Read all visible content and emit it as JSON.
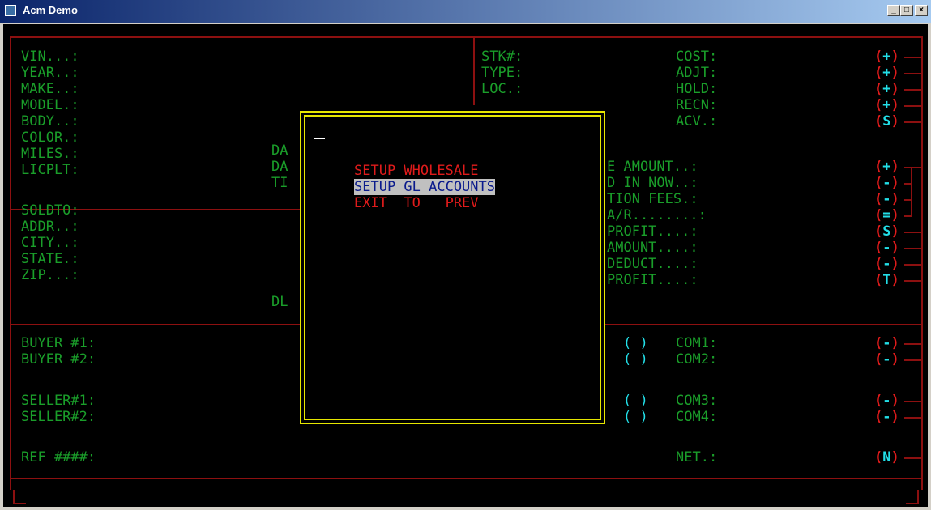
{
  "window": {
    "title": "Acm Demo",
    "buttons": [
      "_",
      "□",
      "×"
    ]
  },
  "left_fields": {
    "vin": "VIN...:",
    "year": "YEAR..:",
    "make": "MAKE..:",
    "model": "MODEL.:",
    "body": "BODY..:",
    "color": "COLOR.:",
    "miles": "MILES.:",
    "licplt": "LICPLT:",
    "soldto": "SOLDTO:",
    "addr": "ADDR..:",
    "city": "CITY..:",
    "state": "STATE.:",
    "zip": "ZIP...:",
    "buyer1": "BUYER #1:",
    "buyer2": "BUYER #2:",
    "seller1": "SELLER#1:",
    "seller2": "SELLER#2:",
    "ref": "REF ####:"
  },
  "mid_partial": {
    "da1": "DA",
    "da2": "DA",
    "ti": "TI",
    "dl": "DL"
  },
  "top_mid": {
    "stk": "STK#:",
    "type": "TYPE:",
    "loc": "LOC.:"
  },
  "right_fields": {
    "cost": "COST:",
    "adjt": "ADJT:",
    "hold": "HOLD:",
    "recn": "RECN:",
    "acv": "ACV.:",
    "e_amount": "E AMOUNT..:",
    "d_in_now": "D IN NOW..:",
    "tion_fees": "TION FEES.:",
    "ar": "A/R........:",
    "profit1": "PROFIT....:",
    "amount": "AMOUNT....:",
    "deduct": "DEDUCT....:",
    "profit2": "PROFIT....:",
    "com1": "COM1:",
    "com2": "COM2:",
    "com3": "COM3:",
    "com4": "COM4:",
    "net": "NET.:",
    "paren": "( )"
  },
  "signs": [
    "+",
    "+",
    "+",
    "+",
    "S",
    "+",
    "-",
    "-",
    "=",
    "S",
    "-",
    "-",
    "T",
    "-",
    "-",
    "-",
    "-",
    "N"
  ],
  "menu": {
    "items": [
      "SETUP WHOLESALE",
      "SETUP GL ACCOUNTS",
      "EXIT  TO   PREV"
    ],
    "selected_index": 1
  },
  "colors": {
    "label": "#1a9e2a",
    "value": "#22dfe8",
    "frame": "#8c1010",
    "menu_border": "#e6e600",
    "menu_text": "#e01b1b",
    "highlight_bg": "#c0c0c0",
    "highlight_fg": "#0a1a8c"
  }
}
